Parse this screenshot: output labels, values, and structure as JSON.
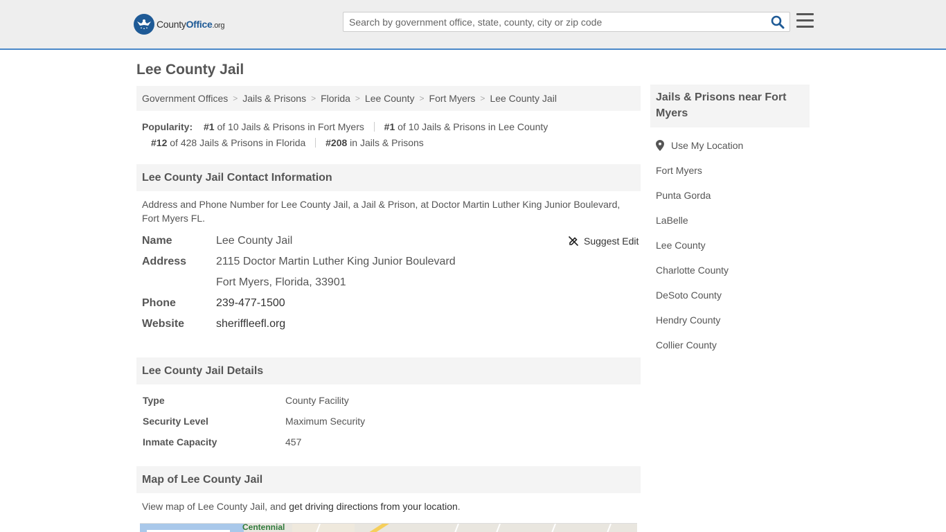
{
  "header": {
    "logo": {
      "name_part1": "County",
      "name_part2": "Office",
      "tld": ".org"
    },
    "search": {
      "placeholder": "Search by government office, state, county, city or zip code",
      "value": ""
    }
  },
  "page": {
    "title": "Lee County Jail"
  },
  "breadcrumb": [
    {
      "label": "Government Offices"
    },
    {
      "label": "Jails & Prisons"
    },
    {
      "label": "Florida"
    },
    {
      "label": "Lee County"
    },
    {
      "label": "Fort Myers"
    },
    {
      "label": "Lee County Jail"
    }
  ],
  "popularity": {
    "label": "Popularity:",
    "items": [
      {
        "rank": "#1",
        "text": "of 10 Jails & Prisons in Fort Myers"
      },
      {
        "rank": "#1",
        "text": "of 10 Jails & Prisons in Lee County"
      },
      {
        "rank": "#12",
        "text": "of 428 Jails & Prisons in Florida"
      },
      {
        "rank": "#208",
        "text": "in Jails & Prisons"
      }
    ]
  },
  "contact": {
    "heading": "Lee County Jail Contact Information",
    "description": "Address and Phone Number for Lee County Jail, a Jail & Prison, at Doctor Martin Luther King Junior Boulevard, Fort Myers FL.",
    "suggest_edit": "Suggest Edit",
    "name_label": "Name",
    "name_value": "Lee County Jail",
    "address_label": "Address",
    "address_line1": "2115 Doctor Martin Luther King Junior Boulevard",
    "address_line2": "Fort Myers, Florida, 33901",
    "phone_label": "Phone",
    "phone_value": "239-477-1500",
    "website_label": "Website",
    "website_value": "sheriffleefl.org"
  },
  "details": {
    "heading": "Lee County Jail Details",
    "rows": [
      {
        "label": "Type",
        "value": "County Facility"
      },
      {
        "label": "Security Level",
        "value": "Maximum Security"
      },
      {
        "label": "Inmate Capacity",
        "value": "457"
      }
    ]
  },
  "map": {
    "heading": "Map of Lee County Jail",
    "desc_prefix": "View map of Lee County Jail, and ",
    "desc_link": "get driving directions from your location",
    "desc_suffix": ".",
    "label": "Centennial"
  },
  "sidebar": {
    "heading": "Jails & Prisons near Fort Myers",
    "use_location": "Use My Location",
    "links": [
      {
        "label": "Fort Myers"
      },
      {
        "label": "Punta Gorda"
      },
      {
        "label": "LaBelle"
      },
      {
        "label": "Lee County"
      },
      {
        "label": "Charlotte County"
      },
      {
        "label": "DeSoto County"
      },
      {
        "label": "Hendry County"
      },
      {
        "label": "Collier County"
      }
    ]
  },
  "colors": {
    "brand": "#1e5a96",
    "accent_border": "#4a88c8",
    "panel_bg": "#f4f4f4",
    "header_bg": "#eeeeee"
  }
}
